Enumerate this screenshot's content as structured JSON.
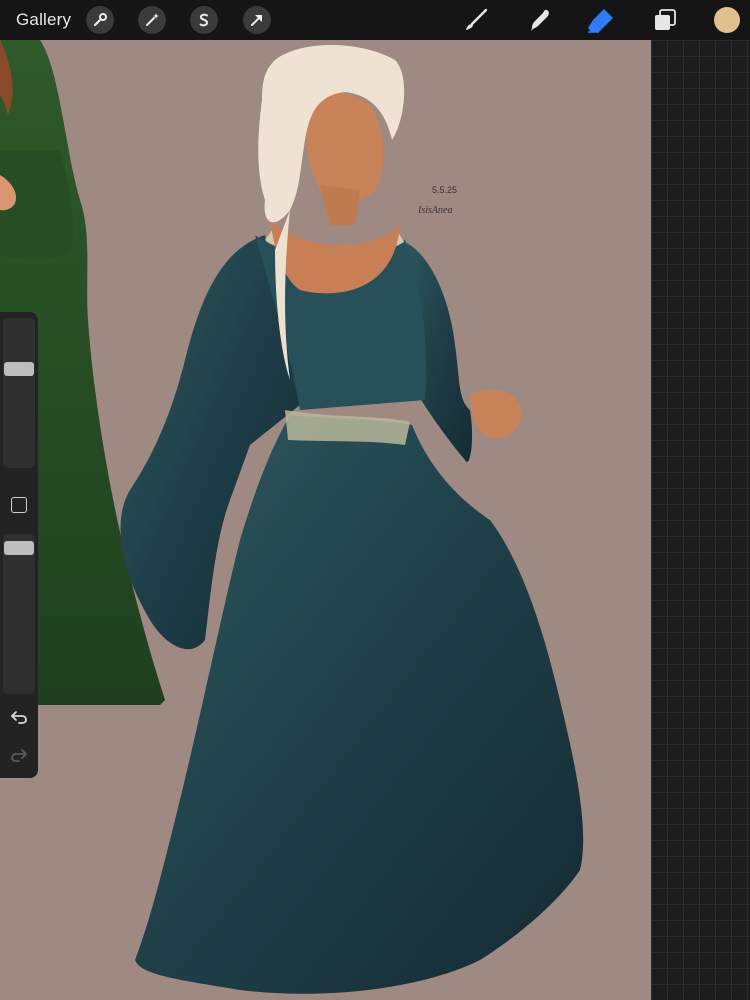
{
  "toolbar": {
    "gallery_label": "Gallery",
    "left_tools": [
      "wrench-icon",
      "magic-wand-icon",
      "selection-s-icon",
      "transform-arrow-icon"
    ],
    "right_tools": [
      "brush-icon",
      "smudge-icon",
      "eraser-icon",
      "layers-icon"
    ],
    "active_tool": "eraser",
    "accent_color": "#2f7cf6",
    "current_color": "#dfc08e"
  },
  "sidebar": {
    "brush_size": 0.68,
    "opacity": 0.95
  },
  "canvas": {
    "background_color": "#9e8983",
    "signature_date": "5.5.25",
    "signature_name": "IsisAnea"
  }
}
